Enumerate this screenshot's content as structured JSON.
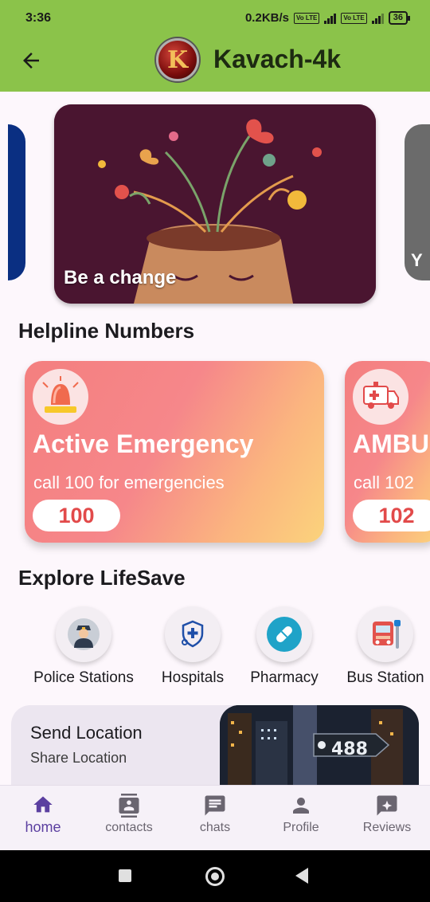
{
  "status_bar": {
    "time": "3:36",
    "net_speed": "0.2KB/s",
    "volte1": "Vo LTE",
    "network_type": "4G",
    "volte2": "Vo LTE",
    "battery": "36"
  },
  "app_bar": {
    "title": "Kavach-4k",
    "logo_letter": "K",
    "back_icon": "arrow-left-icon"
  },
  "carousel": {
    "current_caption": "Be a change",
    "next_caption_fragment": "Y"
  },
  "helpline": {
    "title": "Helpline Numbers",
    "cards": [
      {
        "title": "Active Emergency",
        "subtitle": "call 100 for emergencies",
        "number": "100",
        "icon": "siren-icon"
      },
      {
        "title": "AMBU",
        "subtitle": "call 102",
        "number": "102",
        "icon": "ambulance-icon"
      }
    ]
  },
  "explore": {
    "title": "Explore LifeSave",
    "items": [
      {
        "label": "Police Stations",
        "icon": "police-icon"
      },
      {
        "label": "Hospitals",
        "icon": "hospital-icon"
      },
      {
        "label": "Pharmacy",
        "icon": "pharmacy-icon"
      },
      {
        "label": "Bus Station",
        "icon": "bus-icon"
      }
    ]
  },
  "location_card": {
    "title": "Send Location",
    "subtitle": "Share Location",
    "image_text": "488"
  },
  "bottom_nav": {
    "items": [
      {
        "label": "home",
        "icon": "home-icon",
        "active": true
      },
      {
        "label": "contacts",
        "icon": "contacts-icon",
        "active": false
      },
      {
        "label": "chats",
        "icon": "chat-icon",
        "active": false
      },
      {
        "label": "Profile",
        "icon": "person-icon",
        "active": false
      },
      {
        "label": "Reviews",
        "icon": "reviews-icon",
        "active": false
      }
    ]
  },
  "colors": {
    "app_bar": "#8bc34a",
    "nav_active": "#5b3fa0",
    "helpline_number": "#e24a4a"
  }
}
